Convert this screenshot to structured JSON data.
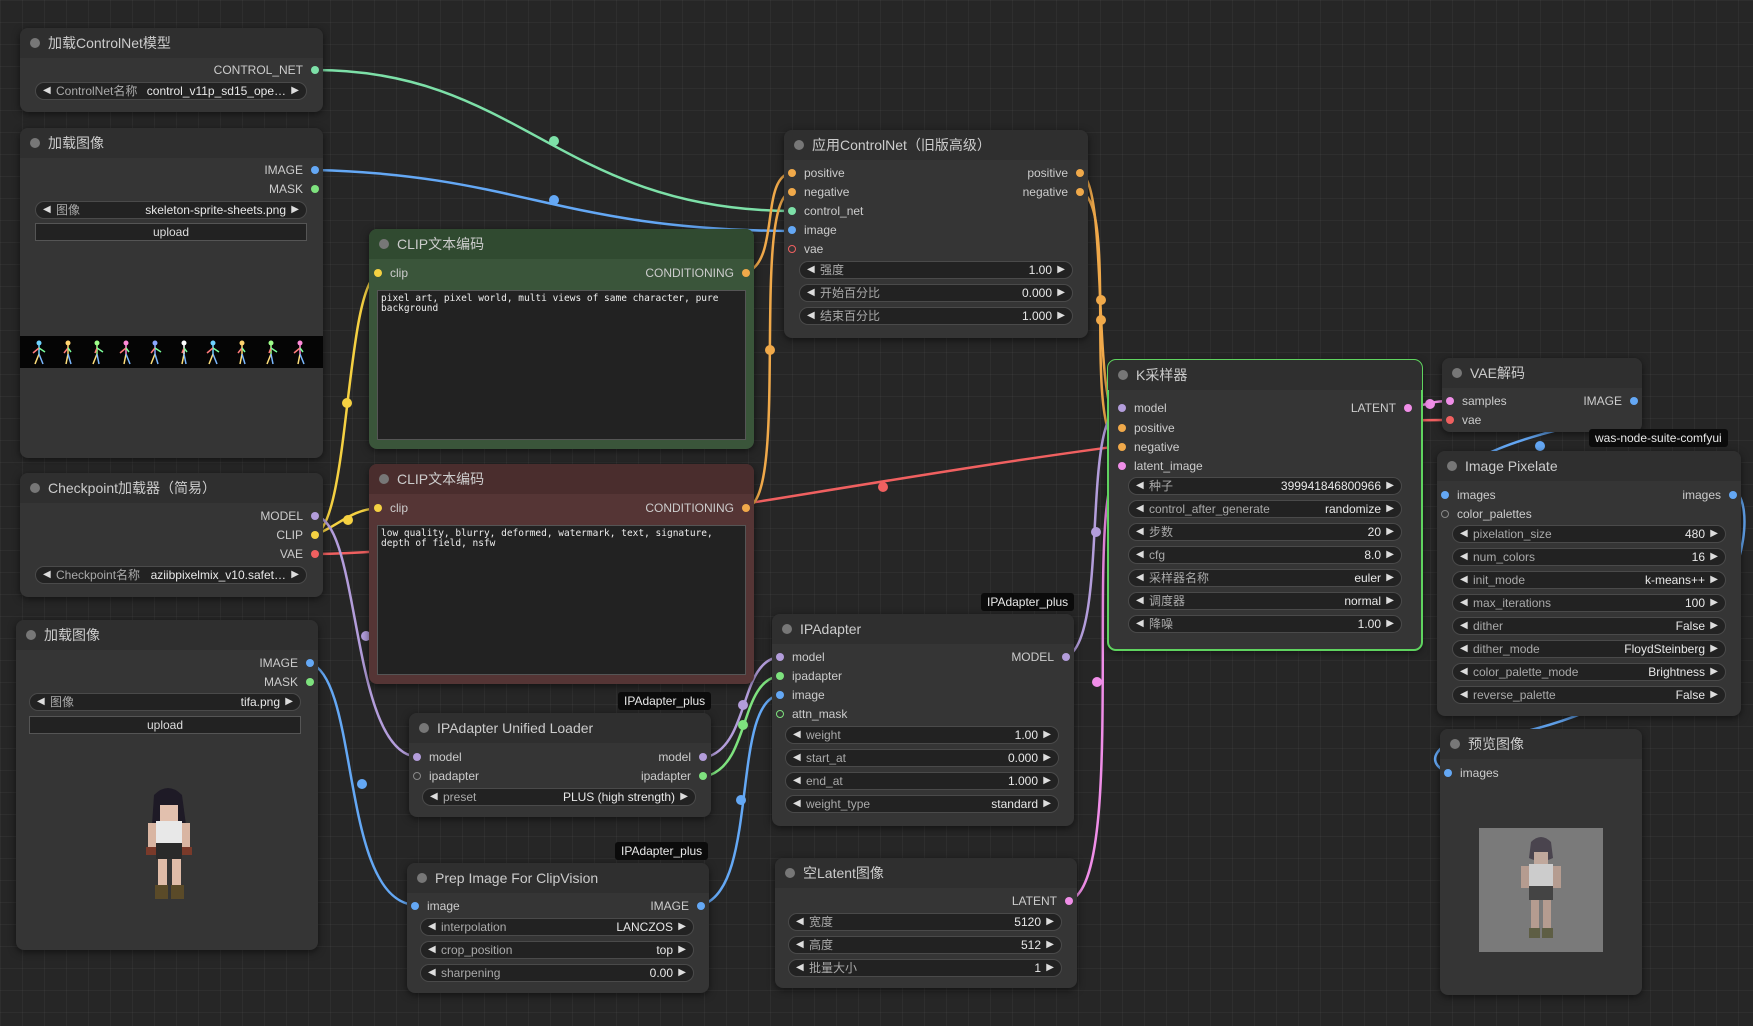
{
  "nodes": {
    "controlnet_loader": {
      "title": "加载ControlNet模型",
      "out": "CONTROL_NET",
      "w_label": "ControlNet名称",
      "w_value": "control_v11p_sd15_ope…"
    },
    "load_image_1": {
      "title": "加载图像",
      "out_image": "IMAGE",
      "out_mask": "MASK",
      "w_label": "图像",
      "w_value": "skeleton-sprite-sheets.png",
      "upload": "upload"
    },
    "clip_pos": {
      "title": "CLIP文本编码",
      "in": "clip",
      "out": "CONDITIONING",
      "text": "pixel art, pixel world, multi views of same character, pure background"
    },
    "clip_neg": {
      "title": "CLIP文本编码",
      "in": "clip",
      "out": "CONDITIONING",
      "text": "low quality, blurry, deformed, watermark, text, signature, depth of field, nsfw"
    },
    "apply_controlnet": {
      "title": "应用ControlNet（旧版高级）",
      "in": [
        "positive",
        "negative",
        "control_net",
        "image",
        "vae"
      ],
      "out": [
        "positive",
        "negative"
      ],
      "widgets": [
        {
          "label": "强度",
          "value": "1.00"
        },
        {
          "label": "开始百分比",
          "value": "0.000"
        },
        {
          "label": "结束百分比",
          "value": "1.000"
        }
      ]
    },
    "checkpoint": {
      "title": "Checkpoint加载器（简易）",
      "out": [
        "MODEL",
        "CLIP",
        "VAE"
      ],
      "w_label": "Checkpoint名称",
      "w_value": "aziibpixelmix_v10.safet…"
    },
    "ksampler": {
      "title": "K采样器",
      "in": [
        "model",
        "positive",
        "negative",
        "latent_image"
      ],
      "out": "LATENT",
      "widgets": [
        {
          "label": "种子",
          "value": "399941846800966"
        },
        {
          "label": "control_after_generate",
          "value": "randomize"
        },
        {
          "label": "步数",
          "value": "20"
        },
        {
          "label": "cfg",
          "value": "8.0"
        },
        {
          "label": "采样器名称",
          "value": "euler"
        },
        {
          "label": "调度器",
          "value": "normal"
        },
        {
          "label": "降噪",
          "value": "1.00"
        }
      ]
    },
    "vae_decode": {
      "title": "VAE解码",
      "in": [
        "samples",
        "vae"
      ],
      "out": "IMAGE"
    },
    "pixelate": {
      "title": "Image Pixelate",
      "badge": "was-node-suite-comfyui",
      "in": [
        "images",
        "color_palettes"
      ],
      "out": "images",
      "widgets": [
        {
          "label": "pixelation_size",
          "value": "480"
        },
        {
          "label": "num_colors",
          "value": "16"
        },
        {
          "label": "init_mode",
          "value": "k-means++"
        },
        {
          "label": "max_iterations",
          "value": "100"
        },
        {
          "label": "dither",
          "value": "False"
        },
        {
          "label": "dither_mode",
          "value": "FloydSteinberg"
        },
        {
          "label": "color_palette_mode",
          "value": "Brightness"
        },
        {
          "label": "reverse_palette",
          "value": "False"
        }
      ]
    },
    "preview": {
      "title": "预览图像",
      "in": "images"
    },
    "load_image_2": {
      "title": "加载图像",
      "out_image": "IMAGE",
      "out_mask": "MASK",
      "w_label": "图像",
      "w_value": "tifa.png",
      "upload": "upload"
    },
    "ipa_loader": {
      "title": "IPAdapter Unified Loader",
      "badge": "IPAdapter_plus",
      "in": [
        "model",
        "ipadapter"
      ],
      "out": [
        "model",
        "ipadapter"
      ],
      "w_label": "preset",
      "w_value": "PLUS (high strength)"
    },
    "ipadapter": {
      "title": "IPAdapter",
      "badge": "IPAdapter_plus",
      "in": [
        "model",
        "ipadapter",
        "image",
        "attn_mask"
      ],
      "out": "MODEL",
      "widgets": [
        {
          "label": "weight",
          "value": "1.00"
        },
        {
          "label": "start_at",
          "value": "0.000"
        },
        {
          "label": "end_at",
          "value": "1.000"
        },
        {
          "label": "weight_type",
          "value": "standard"
        }
      ]
    },
    "prep_image": {
      "title": "Prep Image For ClipVision",
      "badge": "IPAdapter_plus",
      "in": "image",
      "out": "IMAGE",
      "widgets": [
        {
          "label": "interpolation",
          "value": "LANCZOS"
        },
        {
          "label": "crop_position",
          "value": "top"
        },
        {
          "label": "sharpening",
          "value": "0.00"
        }
      ]
    },
    "empty_latent": {
      "title": "空Latent图像",
      "out": "LATENT",
      "widgets": [
        {
          "label": "宽度",
          "value": "5120"
        },
        {
          "label": "高度",
          "value": "512"
        },
        {
          "label": "批量大小",
          "value": "1"
        }
      ]
    }
  },
  "colors": {
    "model": "#b39ddb",
    "clip": "#f5d142",
    "vae": "#f06060",
    "conditioning": "#f0a94a",
    "control_net": "#7de0a8",
    "image": "#64a8f5",
    "latent": "#f08ee8",
    "mask": "#7ee27e",
    "ipadapter": "#7ee27e"
  }
}
